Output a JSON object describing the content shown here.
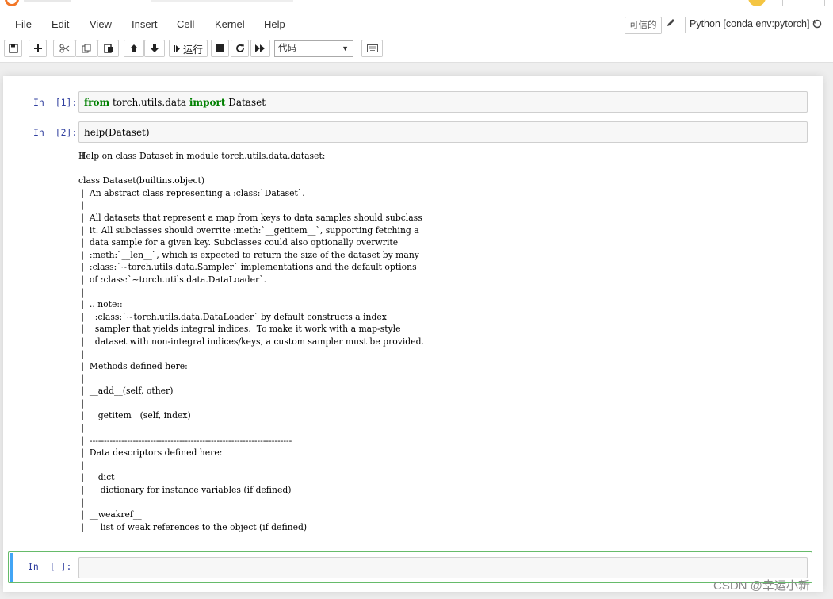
{
  "menu": {
    "items": [
      "File",
      "Edit",
      "View",
      "Insert",
      "Cell",
      "Kernel",
      "Help"
    ],
    "trusted_label": "可信的",
    "kernel_name": "Python [conda env:pytorch] *"
  },
  "toolbar": {
    "run_label": "运行",
    "cell_type_value": "代码"
  },
  "cells": [
    {
      "prompt": "In  [1]:",
      "source": {
        "kw1": "from",
        "mod": " torch.utils.data ",
        "kw2": "import",
        "name": " Dataset"
      }
    },
    {
      "prompt": "In  [2]:",
      "source": {
        "code": "help(Dataset)"
      },
      "output": "Help on class Dataset in module torch.utils.data.dataset:\n\nclass Dataset(builtins.object)\n |  An abstract class representing a :class:`Dataset`.\n |  \n |  All datasets that represent a map from keys to data samples should subclass\n |  it. All subclasses should overrite :meth:`__getitem__`, supporting fetching a\n |  data sample for a given key. Subclasses could also optionally overwrite\n |  :meth:`__len__`, which is expected to return the size of the dataset by many\n |  :class:`~torch.utils.data.Sampler` implementations and the default options\n |  of :class:`~torch.utils.data.DataLoader`.\n |  \n |  .. note::\n |    :class:`~torch.utils.data.DataLoader` by default constructs a index\n |    sampler that yields integral indices.  To make it work with a map-style\n |    dataset with non-integral indices/keys, a custom sampler must be provided.\n |  \n |  Methods defined here:\n |  \n |  __add__(self, other)\n |  \n |  __getitem__(self, index)\n |  \n |  ----------------------------------------------------------------------\n |  Data descriptors defined here:\n |  \n |  __dict__\n |      dictionary for instance variables (if defined)\n |  \n |  __weakref__\n |      list of weak references to the object (if defined)"
    },
    {
      "prompt": "In  [ ]:",
      "source": {
        "code": ""
      }
    }
  ],
  "watermark": "CSDN @幸运小新",
  "colors": {
    "prompt": "#303f9f",
    "keyword": "#008000",
    "selected_border": "#66bb6a",
    "selected_bar": "#42a5f5",
    "logo": "#f37626"
  },
  "icons": [
    "save-icon",
    "plus-icon",
    "cut-icon",
    "copy-icon",
    "paste-icon",
    "arrow-up-icon",
    "arrow-down-icon",
    "step-forward-icon",
    "stop-icon",
    "restart-icon",
    "fast-forward-icon",
    "keyboard-icon",
    "pencil-icon",
    "kernel-idle-icon"
  ]
}
